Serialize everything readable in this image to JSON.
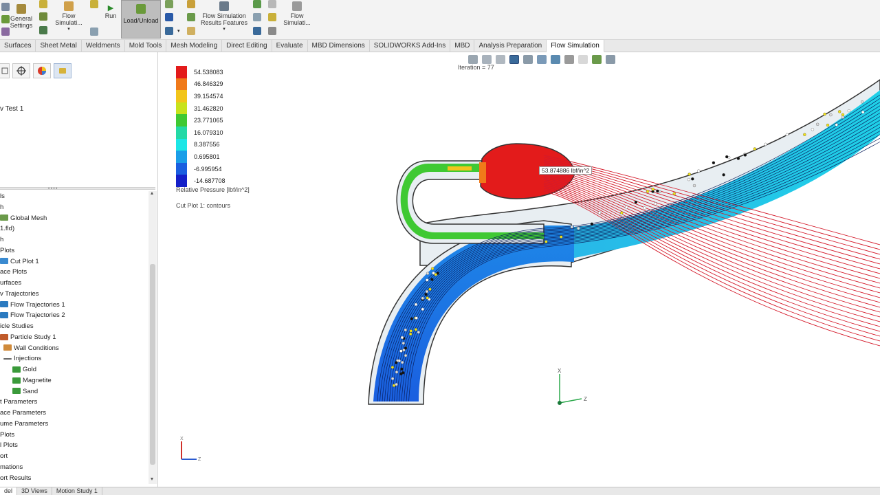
{
  "ribbon": {
    "general_settings": "General\nSettings",
    "flow_simulation_1": "Flow\nSimulati...",
    "run": "Run",
    "load_unload": "Load/Unload",
    "flow_results_features": "Flow Simulation\nResults Features",
    "flow_simulation_2": "Flow\nSimulati..."
  },
  "tabs": [
    "Surfaces",
    "Sheet Metal",
    "Weldments",
    "Mold Tools",
    "Mesh Modeling",
    "Direct Editing",
    "Evaluate",
    "MBD Dimensions",
    "SOLIDWORKS Add-Ins",
    "MBD",
    "Analysis Preparation",
    "Flow Simulation"
  ],
  "active_tab": "Flow Simulation",
  "left_panel": {
    "project_name": "v Test 1",
    "tree": [
      {
        "label": "ls",
        "icon": "folder"
      },
      {
        "label": "h",
        "icon": "none"
      },
      {
        "label": "Global Mesh",
        "icon": "mesh"
      },
      {
        "label": "1.fld)",
        "icon": "none"
      },
      {
        "label": "h",
        "icon": "none"
      },
      {
        "label": "Plots",
        "icon": "none"
      },
      {
        "label": "Cut Plot 1",
        "icon": "cut-plot"
      },
      {
        "label": "ace Plots",
        "icon": "none"
      },
      {
        "label": "urfaces",
        "icon": "none"
      },
      {
        "label": "v Trajectories",
        "icon": "none"
      },
      {
        "label": "Flow Trajectories 1",
        "icon": "trajectory"
      },
      {
        "label": "Flow Trajectories 2",
        "icon": "trajectory"
      },
      {
        "label": "icle Studies",
        "icon": "none"
      },
      {
        "label": "Particle Study 1",
        "icon": "particle"
      },
      {
        "label": "Wall Conditions",
        "icon": "wall"
      },
      {
        "label": "Injections",
        "icon": "injection"
      },
      {
        "label": "Gold",
        "icon": "material"
      },
      {
        "label": "Magnetite",
        "icon": "material"
      },
      {
        "label": "Sand",
        "icon": "material"
      },
      {
        "label": "t Parameters",
        "icon": "none"
      },
      {
        "label": "ace Parameters",
        "icon": "none"
      },
      {
        "label": "ume Parameters",
        "icon": "none"
      },
      {
        "label": "Plots",
        "icon": "none"
      },
      {
        "label": "l Plots",
        "icon": "none"
      },
      {
        "label": "ort",
        "icon": "none"
      },
      {
        "label": "mations",
        "icon": "none"
      },
      {
        "label": "ort Results",
        "icon": "none"
      }
    ]
  },
  "viewport": {
    "iteration": "Iteration = 77",
    "probe_value": "53.874886 lbf/in^2",
    "legend_title": "Relative Pressure [lbf/in^2]",
    "cut_plot_label": "Cut Plot 1: contours",
    "legend": [
      {
        "value": "54.538083",
        "color": "#e31b1b"
      },
      {
        "value": "46.846329",
        "color": "#f07a1a"
      },
      {
        "value": "39.154574",
        "color": "#f2c51a"
      },
      {
        "value": "31.462820",
        "color": "#c8e21c"
      },
      {
        "value": "23.771065",
        "color": "#3fc933"
      },
      {
        "value": "16.079310",
        "color": "#24d9a6"
      },
      {
        "value": "8.387556",
        "color": "#1ce6e6"
      },
      {
        "value": "0.695801",
        "color": "#1a9ee8"
      },
      {
        "value": "-6.995954",
        "color": "#1a5fe0"
      },
      {
        "value": "-14.687708",
        "color": "#1420c8"
      }
    ],
    "triad_axes": [
      "X",
      "Z"
    ]
  },
  "bottom_tabs": [
    "del",
    "3D Views",
    "Motion Study 1"
  ]
}
